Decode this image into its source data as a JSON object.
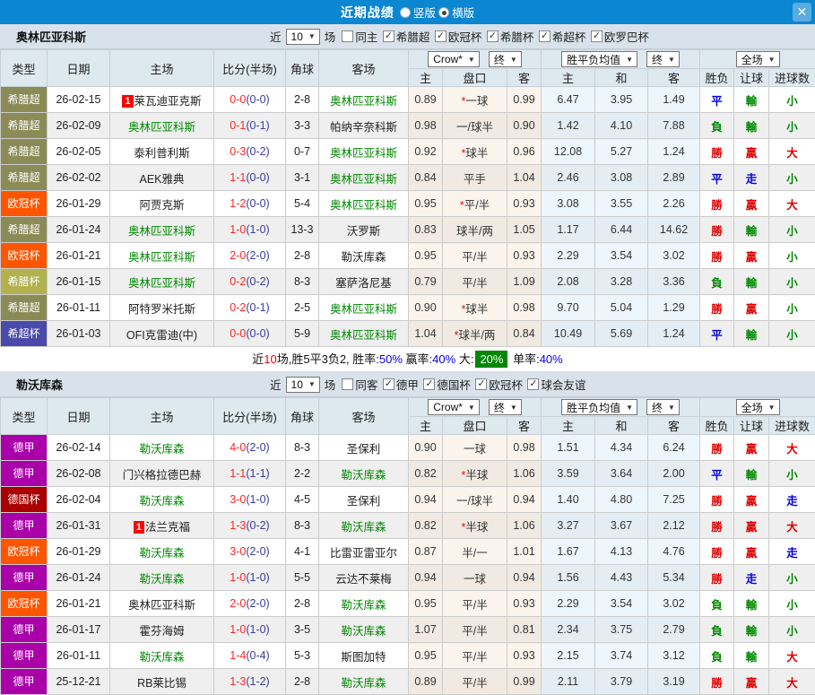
{
  "titlebar": {
    "title": "近期战绩",
    "close_icon": "✕",
    "layout_options": [
      {
        "label": "竖版",
        "checked": false
      },
      {
        "label": "横版",
        "checked": true
      }
    ]
  },
  "columns": {
    "type": "类型",
    "date": "日期",
    "home": "主场",
    "score": "比分(半场)",
    "corner": "角球",
    "away": "客场",
    "odds_home": "主",
    "odds_line": "盘口",
    "odds_away": "客",
    "avg_home": "主",
    "avg_draw": "和",
    "avg_away": "客",
    "wdl": "胜负",
    "handicap": "让球",
    "goals": "进球数"
  },
  "selects": {
    "bookmaker": "Crow*",
    "final1": "终",
    "avg": "胜平负均值",
    "final2": "终",
    "scope": "全场"
  },
  "badge_colors": {
    "希腊超": "#8b8b58",
    "欧冠杯": "#ff5500",
    "希腊杯": "#b1b14e",
    "希超杯": "#4a4aaa",
    "德甲": "#aa00aa",
    "德国杯": "#aa0000"
  },
  "sections": [
    {
      "team": "奥林匹亚科斯",
      "filter": {
        "near_label": "近",
        "games_value": "10",
        "games_suffix": "场",
        "same": {
          "label": "同主",
          "checked": false
        },
        "leagues": [
          {
            "label": "希腊超",
            "checked": true
          },
          {
            "label": "欧冠杯",
            "checked": true
          },
          {
            "label": "希腊杯",
            "checked": true
          },
          {
            "label": "希超杯",
            "checked": true
          },
          {
            "label": "欧罗巴杯",
            "checked": true
          }
        ]
      },
      "rows": [
        {
          "type": "希腊超",
          "date": "26-02-15",
          "home": "莱瓦迪亚克斯",
          "home_rank": "1",
          "home_green": false,
          "score": "0-0",
          "half": "(0-0)",
          "corner": "2-8",
          "away": "奥林匹亚科斯",
          "away_rank": "",
          "away_green": true,
          "oh": "0.89",
          "line_star": true,
          "line": "一球",
          "oa": "0.99",
          "ah": "6.47",
          "ad": "3.95",
          "aa": "1.49",
          "wdl": "平",
          "wdl_c": "b",
          "hcp": "輸",
          "hcp_c": "g",
          "goal": "小",
          "goal_c": "g"
        },
        {
          "type": "希腊超",
          "date": "26-02-09",
          "home": "奥林匹亚科斯",
          "home_rank": "",
          "home_green": true,
          "score": "0-1",
          "half": "(0-1)",
          "corner": "3-3",
          "away": "帕纳辛奈科斯",
          "away_rank": "",
          "away_green": false,
          "oh": "0.98",
          "line_star": false,
          "line": "一/球半",
          "oa": "0.90",
          "ah": "1.42",
          "ad": "4.10",
          "aa": "7.88",
          "wdl": "負",
          "wdl_c": "g",
          "hcp": "輸",
          "hcp_c": "g",
          "goal": "小",
          "goal_c": "g"
        },
        {
          "type": "希腊超",
          "date": "26-02-05",
          "home": "泰利普利斯",
          "home_rank": "",
          "home_green": false,
          "score": "0-3",
          "half": "(0-2)",
          "corner": "0-7",
          "away": "奥林匹亚科斯",
          "away_rank": "",
          "away_green": true,
          "oh": "0.92",
          "line_star": true,
          "line": "球半",
          "oa": "0.96",
          "ah": "12.08",
          "ad": "5.27",
          "aa": "1.24",
          "wdl": "勝",
          "wdl_c": "r",
          "hcp": "贏",
          "hcp_c": "r",
          "goal": "大",
          "goal_c": "r"
        },
        {
          "type": "希腊超",
          "date": "26-02-02",
          "home": "AEK雅典",
          "home_rank": "",
          "home_green": false,
          "score": "1-1",
          "half": "(0-0)",
          "corner": "3-1",
          "away": "奥林匹亚科斯",
          "away_rank": "",
          "away_green": true,
          "oh": "0.84",
          "line_star": false,
          "line": "平手",
          "oa": "1.04",
          "ah": "2.46",
          "ad": "3.08",
          "aa": "2.89",
          "wdl": "平",
          "wdl_c": "b",
          "hcp": "走",
          "hcp_c": "b",
          "goal": "小",
          "goal_c": "g"
        },
        {
          "type": "欧冠杯",
          "date": "26-01-29",
          "home": "阿贾克斯",
          "home_rank": "",
          "home_green": false,
          "score": "1-2",
          "half": "(0-0)",
          "corner": "5-4",
          "away": "奥林匹亚科斯",
          "away_rank": "",
          "away_green": true,
          "oh": "0.95",
          "line_star": true,
          "line": "平/半",
          "oa": "0.93",
          "ah": "3.08",
          "ad": "3.55",
          "aa": "2.26",
          "wdl": "勝",
          "wdl_c": "r",
          "hcp": "贏",
          "hcp_c": "r",
          "goal": "大",
          "goal_c": "r"
        },
        {
          "type": "希腊超",
          "date": "26-01-24",
          "home": "奥林匹亚科斯",
          "home_rank": "",
          "home_green": true,
          "score": "1-0",
          "half": "(1-0)",
          "corner": "13-3",
          "away": "沃罗斯",
          "away_rank": "",
          "away_green": false,
          "oh": "0.83",
          "line_star": false,
          "line": "球半/两",
          "oa": "1.05",
          "ah": "1.17",
          "ad": "6.44",
          "aa": "14.62",
          "wdl": "勝",
          "wdl_c": "r",
          "hcp": "輸",
          "hcp_c": "g",
          "goal": "小",
          "goal_c": "g"
        },
        {
          "type": "欧冠杯",
          "date": "26-01-21",
          "home": "奥林匹亚科斯",
          "home_rank": "",
          "home_green": true,
          "score": "2-0",
          "half": "(2-0)",
          "corner": "2-8",
          "away": "勒沃库森",
          "away_rank": "",
          "away_green": false,
          "oh": "0.95",
          "line_star": false,
          "line": "平/半",
          "oa": "0.93",
          "ah": "2.29",
          "ad": "3.54",
          "aa": "3.02",
          "wdl": "勝",
          "wdl_c": "r",
          "hcp": "贏",
          "hcp_c": "r",
          "goal": "小",
          "goal_c": "g"
        },
        {
          "type": "希腊杯",
          "date": "26-01-15",
          "home": "奥林匹亚科斯",
          "home_rank": "",
          "home_green": true,
          "score": "0-2",
          "half": "(0-2)",
          "corner": "8-3",
          "away": "塞萨洛尼基",
          "away_rank": "",
          "away_green": false,
          "oh": "0.79",
          "line_star": false,
          "line": "平/半",
          "oa": "1.09",
          "ah": "2.08",
          "ad": "3.28",
          "aa": "3.36",
          "wdl": "負",
          "wdl_c": "g",
          "hcp": "輸",
          "hcp_c": "g",
          "goal": "小",
          "goal_c": "g"
        },
        {
          "type": "希腊超",
          "date": "26-01-11",
          "home": "阿特罗米托斯",
          "home_rank": "",
          "home_green": false,
          "score": "0-2",
          "half": "(0-1)",
          "corner": "2-5",
          "away": "奥林匹亚科斯",
          "away_rank": "",
          "away_green": true,
          "oh": "0.90",
          "line_star": true,
          "line": "球半",
          "oa": "0.98",
          "ah": "9.70",
          "ad": "5.04",
          "aa": "1.29",
          "wdl": "勝",
          "wdl_c": "r",
          "hcp": "贏",
          "hcp_c": "r",
          "goal": "小",
          "goal_c": "g"
        },
        {
          "type": "希超杯",
          "date": "26-01-03",
          "home": "OFI克雷迪(中)",
          "home_rank": "",
          "home_green": false,
          "score": "0-0",
          "half": "(0-0)",
          "corner": "5-9",
          "away": "奥林匹亚科斯",
          "away_rank": "",
          "away_green": true,
          "oh": "1.04",
          "line_star": true,
          "line": "球半/两",
          "oa": "0.84",
          "ah": "10.49",
          "ad": "5.69",
          "aa": "1.24",
          "wdl": "平",
          "wdl_c": "b",
          "hcp": "輸",
          "hcp_c": "g",
          "goal": "小",
          "goal_c": "g"
        }
      ],
      "summary": [
        {
          "t": "近"
        },
        {
          "t": "10",
          "c": "red"
        },
        {
          "t": "场,胜5平3负2, "
        },
        {
          "t": "胜率:"
        },
        {
          "t": "50%",
          "c": "blue"
        },
        {
          "t": " 赢率:"
        },
        {
          "t": "40%",
          "c": "blue"
        },
        {
          "t": " 大:"
        },
        {
          "t": "20%",
          "c": "badge"
        },
        {
          "t": " 单率:"
        },
        {
          "t": "40%",
          "c": "blue"
        }
      ]
    },
    {
      "team": "勒沃库森",
      "filter": {
        "near_label": "近",
        "games_value": "10",
        "games_suffix": "场",
        "same": {
          "label": "同客",
          "checked": false
        },
        "leagues": [
          {
            "label": "德甲",
            "checked": true
          },
          {
            "label": "德国杯",
            "checked": true
          },
          {
            "label": "欧冠杯",
            "checked": true
          },
          {
            "label": "球会友谊",
            "checked": true
          }
        ]
      },
      "rows": [
        {
          "type": "德甲",
          "date": "26-02-14",
          "home": "勒沃库森",
          "home_rank": "",
          "home_green": true,
          "score": "4-0",
          "half": "(2-0)",
          "corner": "8-3",
          "away": "圣保利",
          "away_rank": "",
          "away_green": false,
          "oh": "0.90",
          "line_star": false,
          "line": "一球",
          "oa": "0.98",
          "ah": "1.51",
          "ad": "4.34",
          "aa": "6.24",
          "wdl": "勝",
          "wdl_c": "r",
          "hcp": "贏",
          "hcp_c": "r",
          "goal": "大",
          "goal_c": "r"
        },
        {
          "type": "德甲",
          "date": "26-02-08",
          "home": "门兴格拉德巴赫",
          "home_rank": "",
          "home_green": false,
          "score": "1-1",
          "half": "(1-1)",
          "corner": "2-2",
          "away": "勒沃库森",
          "away_rank": "",
          "away_green": true,
          "oh": "0.82",
          "line_star": true,
          "line": "半球",
          "oa": "1.06",
          "ah": "3.59",
          "ad": "3.64",
          "aa": "2.00",
          "wdl": "平",
          "wdl_c": "b",
          "hcp": "輸",
          "hcp_c": "g",
          "goal": "小",
          "goal_c": "g"
        },
        {
          "type": "德国杯",
          "date": "26-02-04",
          "home": "勒沃库森",
          "home_rank": "",
          "home_green": true,
          "score": "3-0",
          "half": "(1-0)",
          "corner": "4-5",
          "away": "圣保利",
          "away_rank": "",
          "away_green": false,
          "oh": "0.94",
          "line_star": false,
          "line": "一/球半",
          "oa": "0.94",
          "ah": "1.40",
          "ad": "4.80",
          "aa": "7.25",
          "wdl": "勝",
          "wdl_c": "r",
          "hcp": "贏",
          "hcp_c": "r",
          "goal": "走",
          "goal_c": "b"
        },
        {
          "type": "德甲",
          "date": "26-01-31",
          "home": "法兰克福",
          "home_rank": "1",
          "home_green": false,
          "score": "1-3",
          "half": "(0-2)",
          "corner": "8-3",
          "away": "勒沃库森",
          "away_rank": "",
          "away_green": true,
          "oh": "0.82",
          "line_star": true,
          "line": "半球",
          "oa": "1.06",
          "ah": "3.27",
          "ad": "3.67",
          "aa": "2.12",
          "wdl": "勝",
          "wdl_c": "r",
          "hcp": "贏",
          "hcp_c": "r",
          "goal": "大",
          "goal_c": "r"
        },
        {
          "type": "欧冠杯",
          "date": "26-01-29",
          "home": "勒沃库森",
          "home_rank": "",
          "home_green": true,
          "score": "3-0",
          "half": "(2-0)",
          "corner": "4-1",
          "away": "比雷亚雷亚尔",
          "away_rank": "",
          "away_green": false,
          "oh": "0.87",
          "line_star": false,
          "line": "半/一",
          "oa": "1.01",
          "ah": "1.67",
          "ad": "4.13",
          "aa": "4.76",
          "wdl": "勝",
          "wdl_c": "r",
          "hcp": "贏",
          "hcp_c": "r",
          "goal": "走",
          "goal_c": "b"
        },
        {
          "type": "德甲",
          "date": "26-01-24",
          "home": "勒沃库森",
          "home_rank": "",
          "home_green": true,
          "score": "1-0",
          "half": "(1-0)",
          "corner": "5-5",
          "away": "云达不莱梅",
          "away_rank": "",
          "away_green": false,
          "oh": "0.94",
          "line_star": false,
          "line": "一球",
          "oa": "0.94",
          "ah": "1.56",
          "ad": "4.43",
          "aa": "5.34",
          "wdl": "勝",
          "wdl_c": "r",
          "hcp": "走",
          "hcp_c": "b",
          "goal": "小",
          "goal_c": "g"
        },
        {
          "type": "欧冠杯",
          "date": "26-01-21",
          "home": "奥林匹亚科斯",
          "home_rank": "",
          "home_green": false,
          "score": "2-0",
          "half": "(2-0)",
          "corner": "2-8",
          "away": "勒沃库森",
          "away_rank": "",
          "away_green": true,
          "oh": "0.95",
          "line_star": false,
          "line": "平/半",
          "oa": "0.93",
          "ah": "2.29",
          "ad": "3.54",
          "aa": "3.02",
          "wdl": "負",
          "wdl_c": "g",
          "hcp": "輸",
          "hcp_c": "g",
          "goal": "小",
          "goal_c": "g"
        },
        {
          "type": "德甲",
          "date": "26-01-17",
          "home": "霍芬海姆",
          "home_rank": "",
          "home_green": false,
          "score": "1-0",
          "half": "(1-0)",
          "corner": "3-5",
          "away": "勒沃库森",
          "away_rank": "",
          "away_green": true,
          "oh": "1.07",
          "line_star": false,
          "line": "平/半",
          "oa": "0.81",
          "ah": "2.34",
          "ad": "3.75",
          "aa": "2.79",
          "wdl": "負",
          "wdl_c": "g",
          "hcp": "輸",
          "hcp_c": "g",
          "goal": "小",
          "goal_c": "g"
        },
        {
          "type": "德甲",
          "date": "26-01-11",
          "home": "勒沃库森",
          "home_rank": "",
          "home_green": true,
          "score": "1-4",
          "half": "(0-4)",
          "corner": "5-3",
          "away": "斯图加特",
          "away_rank": "",
          "away_green": false,
          "oh": "0.95",
          "line_star": false,
          "line": "平/半",
          "oa": "0.93",
          "ah": "2.15",
          "ad": "3.74",
          "aa": "3.12",
          "wdl": "負",
          "wdl_c": "g",
          "hcp": "輸",
          "hcp_c": "g",
          "goal": "大",
          "goal_c": "r"
        },
        {
          "type": "德甲",
          "date": "25-12-21",
          "home": "RB莱比锡",
          "home_rank": "",
          "home_green": false,
          "score": "1-3",
          "half": "(1-2)",
          "corner": "2-8",
          "away": "勒沃库森",
          "away_rank": "",
          "away_green": true,
          "oh": "0.89",
          "line_star": false,
          "line": "平/半",
          "oa": "0.99",
          "ah": "2.11",
          "ad": "3.79",
          "aa": "3.19",
          "wdl": "勝",
          "wdl_c": "r",
          "hcp": "贏",
          "hcp_c": "r",
          "goal": "大",
          "goal_c": "r"
        }
      ],
      "summary": null
    }
  ]
}
